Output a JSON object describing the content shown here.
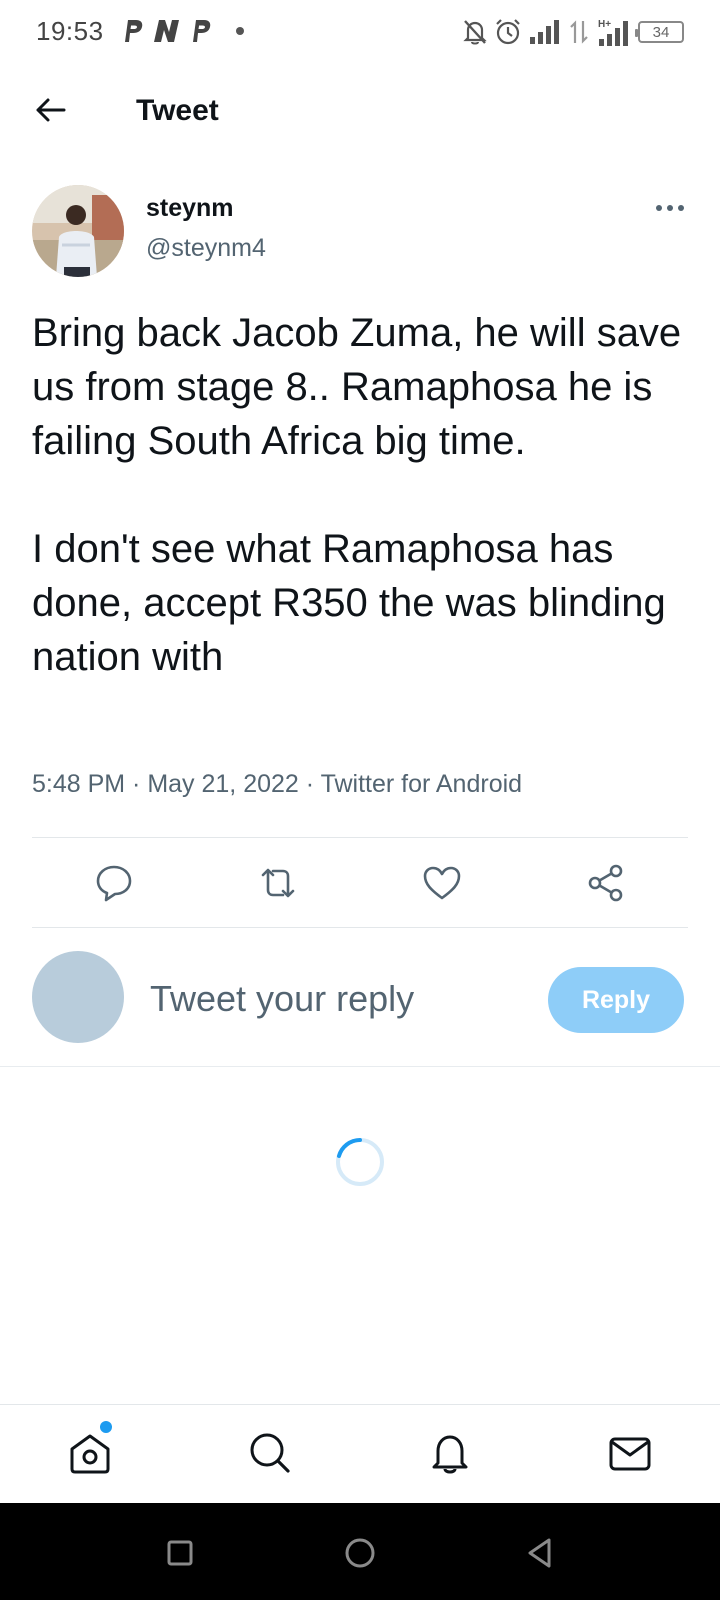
{
  "status_bar": {
    "time": "19:53",
    "battery": "34",
    "app_icons": [
      "p-icon",
      "n-icon",
      "p-icon"
    ],
    "system_icons": [
      "bell-off-icon",
      "alarm-icon",
      "signal-icon",
      "data-icon",
      "signal-h-plus-icon",
      "battery-icon"
    ]
  },
  "header": {
    "title": "Tweet"
  },
  "tweet": {
    "author_name": "steynm",
    "author_handle": "@steynm4",
    "text": "Bring back Jacob Zuma, he will save us from stage 8.. Ramaphosa he is failing South Africa big time.\n\nI don't see what Ramaphosa has done, accept R350 the was blinding nation with",
    "meta": "5:48 PM · May 21, 2022 · Twitter for Android"
  },
  "actions": [
    "reply-icon",
    "retweet-icon",
    "like-icon",
    "share-icon"
  ],
  "reply": {
    "placeholder": "Tweet your reply",
    "button_label": "Reply"
  },
  "bottom_nav": [
    "home-icon",
    "search-icon",
    "notifications-icon",
    "messages-icon"
  ],
  "colors": {
    "accent": "#1d9bf0",
    "reply_button": "#8ecdf8",
    "secondary_text": "#536471",
    "primary_text": "#0f1419"
  }
}
